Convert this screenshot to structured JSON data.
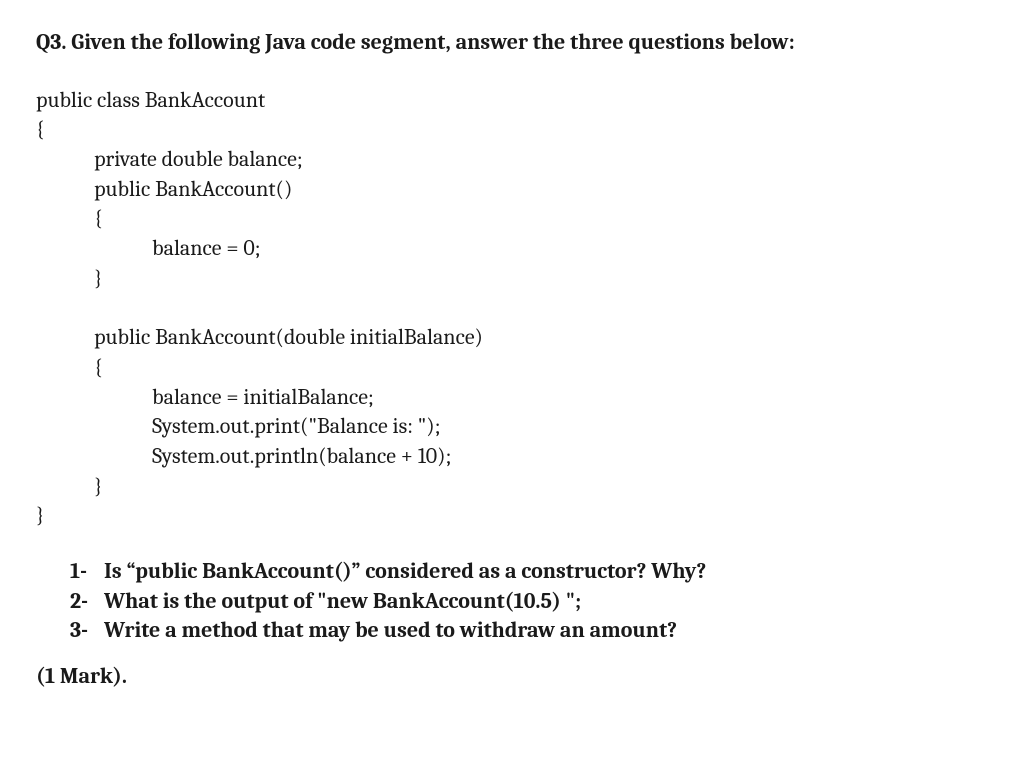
{
  "title": "Q3. Given the following Java code segment, answer the three questions below:",
  "code": "public class BankAccount\n{\n            private double balance;\n            public BankAccount()\n            {\n                        balance = 0;\n            }\n\n            public BankAccount(double initialBalance)\n            {\n                        balance = initialBalance;\n                        System.out.print(\"Balance is: \");\n                        System.out.println(balance + 10);\n            }\n}",
  "questions": [
    {
      "num": "1-",
      "text": "Is “public BankAccount()” considered as a constructor? Why?"
    },
    {
      "num": "2-",
      "text": "What is the output of \"new BankAccount(10.5) \";"
    },
    {
      "num": "3-",
      "text": "Write a method that may be used to withdraw an amount?"
    }
  ],
  "mark": "(1 Mark)."
}
